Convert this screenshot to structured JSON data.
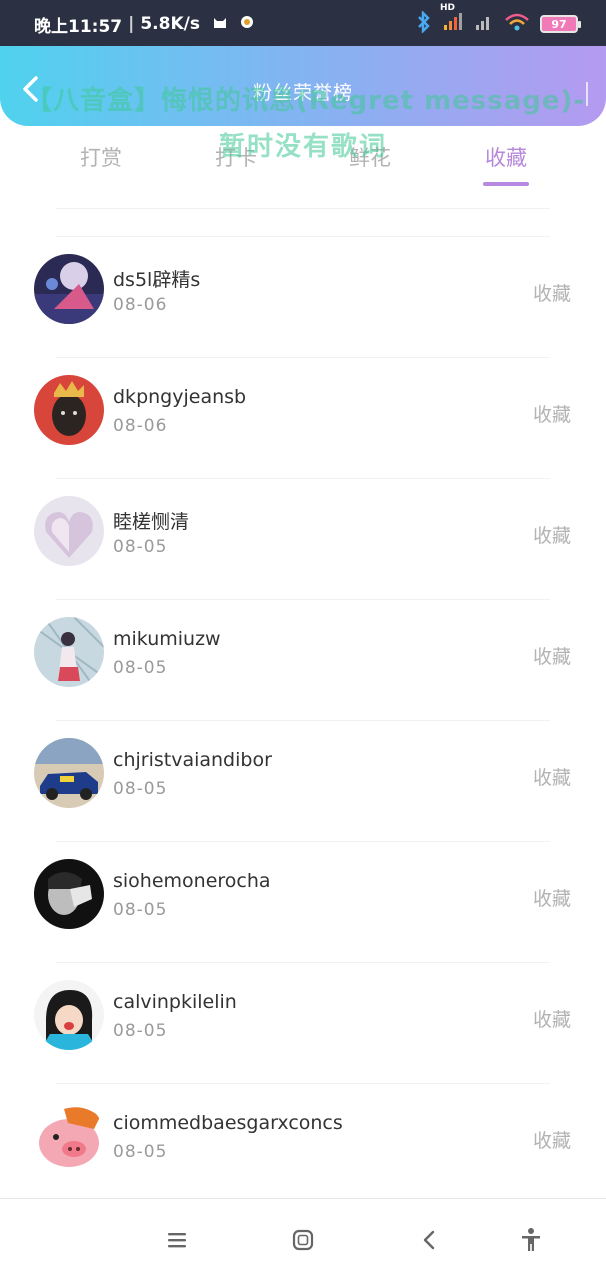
{
  "status_bar": {
    "time": "晚上11:57",
    "speed": "5.8K/s",
    "network_hd": "HD",
    "battery": "97"
  },
  "header": {
    "title": "粉丝荣誉榜",
    "overlay_song": "【八音盒】悔恨的讯息(Regret message)-",
    "overlay_lyrics": "暂时没有歌词",
    "gradient_start": "#4fd2ee",
    "gradient_end": "#b49af0"
  },
  "tabs": [
    {
      "label": "打赏",
      "active": false
    },
    {
      "label": "打卡",
      "active": false
    },
    {
      "label": "鲜花",
      "active": false
    },
    {
      "label": "收藏",
      "active": true
    }
  ],
  "accent_color": "#b689d8",
  "fans": [
    {
      "name": "ds5l辟精s",
      "date": "08-06",
      "action": "收藏"
    },
    {
      "name": "dkpngyjeansb",
      "date": "08-06",
      "action": "收藏"
    },
    {
      "name": "睦槎恻清",
      "date": "08-05",
      "action": "收藏"
    },
    {
      "name": "mikumiuzw",
      "date": "08-05",
      "action": "收藏"
    },
    {
      "name": "chjristvaiandibor",
      "date": "08-05",
      "action": "收藏"
    },
    {
      "name": "siohemonerocha",
      "date": "08-05",
      "action": "收藏"
    },
    {
      "name": "calvinpkilelin",
      "date": "08-05",
      "action": "收藏"
    },
    {
      "name": "ciommedbaesgarxconcs",
      "date": "08-05",
      "action": "收藏"
    }
  ],
  "nav_bar": {
    "buttons": [
      "menu-icon",
      "home-icon",
      "back-icon",
      "accessibility-icon"
    ]
  }
}
